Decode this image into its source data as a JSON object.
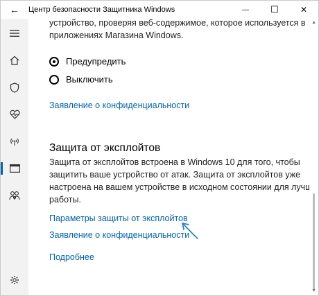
{
  "window": {
    "title": "Центр безопасности Защитника Windows",
    "back_icon": "←",
    "minimize_icon": "—",
    "maximize_icon": "☐",
    "close_icon": "✕"
  },
  "sidebar": {
    "items": [
      {
        "name": "menu-icon"
      },
      {
        "name": "home-icon"
      },
      {
        "name": "shield-icon"
      },
      {
        "name": "health-icon"
      },
      {
        "name": "network-icon"
      },
      {
        "name": "app-browser-icon"
      },
      {
        "name": "family-icon"
      },
      {
        "name": "settings-icon"
      }
    ]
  },
  "content": {
    "intro_line1": "устройство, проверяя веб-содержимое, которое используется в",
    "intro_line2": "приложениях Магазина Windows.",
    "radio_warn": "Предупредить",
    "radio_off": "Выключить",
    "privacy_link_1": "Заявление о конфиденциальности",
    "heading": "Защита от эксплойтов",
    "desc_line1": "Защита от эксплойтов встроена в Windows 10 для того, чтобы",
    "desc_line2": "защитить ваше устройство от атак. Защита от эксплойтов уже",
    "desc_line3": "настроена на вашем устройстве в исходном состоянии для лучшей",
    "desc_line4": "работы.",
    "settings_link": "Параметры защиты от эксплойтов",
    "privacy_link_2": "Заявление о конфиденциальности",
    "more_link": "Подробнее"
  },
  "colors": {
    "accent": "#0063b1",
    "annotation_arrow": "#2a87c8"
  }
}
